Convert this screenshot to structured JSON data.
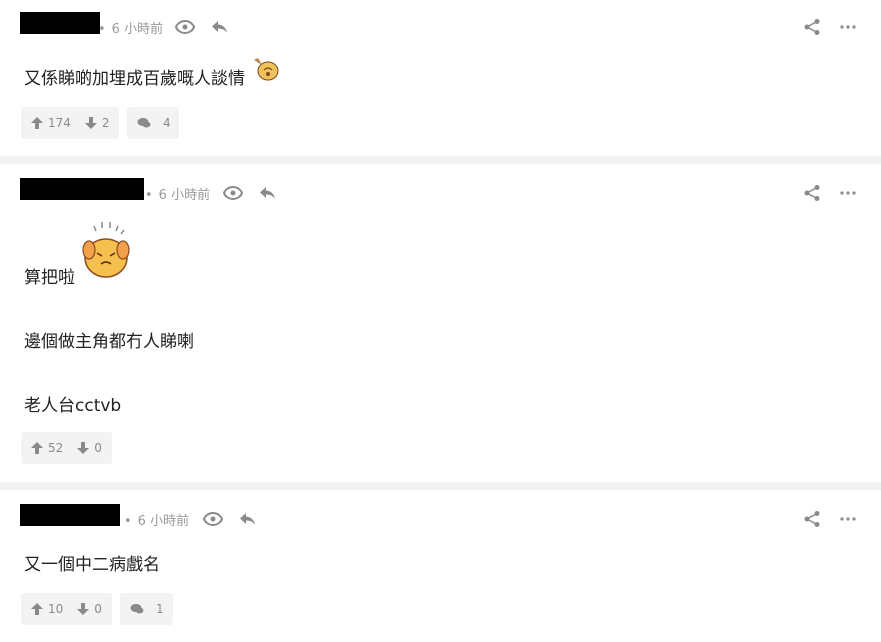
{
  "posts": [
    {
      "time": "6 小時前",
      "content": "又係睇啲加埋成百歲嘅人談情",
      "upvotes": "174",
      "downvotes": "2",
      "replies": "4"
    },
    {
      "time": "6 小時前",
      "lines": [
        "算把啦",
        "邊個做主角都冇人睇喇",
        "老人台cctvb"
      ],
      "upvotes": "52",
      "downvotes": "0"
    },
    {
      "time": "6 小時前",
      "content": "又一個中二病戲名",
      "upvotes": "10",
      "downvotes": "0",
      "replies": "1"
    }
  ],
  "icons": {
    "view": "eye-icon",
    "reply": "reply-arrow-icon",
    "share": "share-icon",
    "more": "more-icon",
    "upvote": "up-arrow-icon",
    "downvote": "down-arrow-icon",
    "comments": "comment-bubble-icon"
  },
  "colors": {
    "icon_gray": "#8a8a8a",
    "divider": "#f2f2f2",
    "button_bg": "#f3f3f3"
  }
}
